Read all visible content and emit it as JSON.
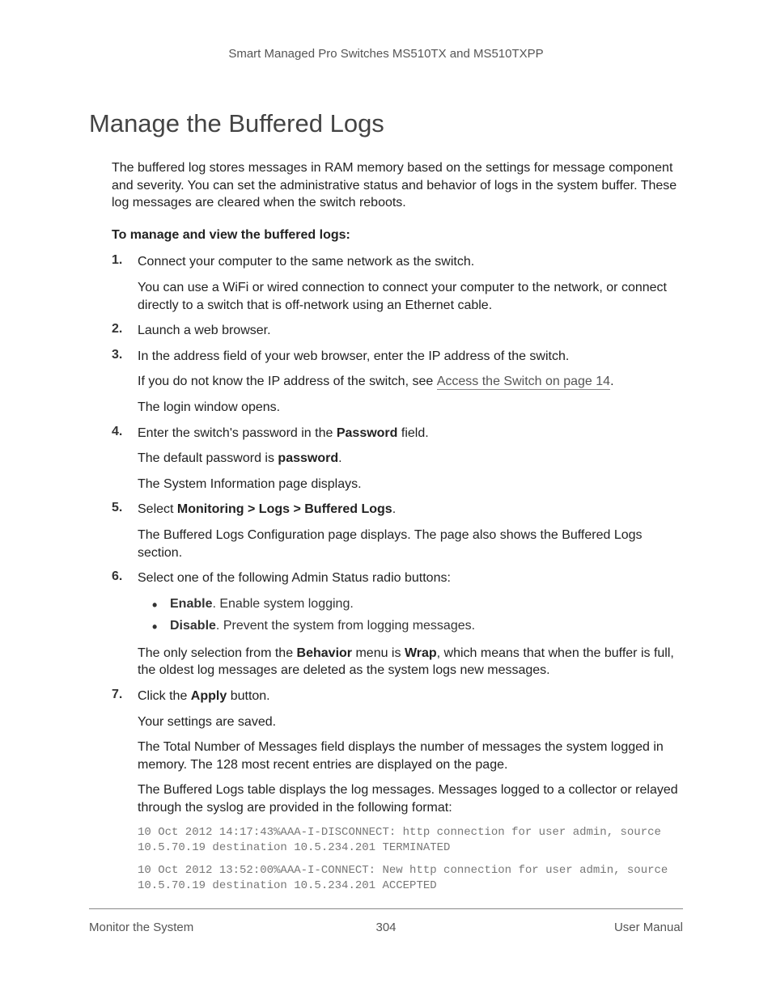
{
  "header": "Smart Managed Pro Switches MS510TX and MS510TXPP",
  "title": "Manage the Buffered Logs",
  "intro": "The buffered log stores messages in RAM memory based on the settings for message component and severity. You can set the administrative status and behavior of logs in the system buffer. These log messages are cleared when the switch reboots.",
  "procHeading": "To manage and view the buffered logs:",
  "steps": {
    "s1": {
      "main": "Connect your computer to the same network as the switch.",
      "sub": "You can use a WiFi or wired connection to connect your computer to the network, or connect directly to a switch that is off-network using an Ethernet cable."
    },
    "s2": {
      "main": "Launch a web browser."
    },
    "s3": {
      "main": "In the address field of your web browser, enter the IP address of the switch.",
      "sub_pre": "If you do not know the IP address of the switch, see ",
      "link": "Access the Switch on page 14",
      "sub_post": ".",
      "sub2": "The login window opens."
    },
    "s4": {
      "main_pre": "Enter the switch's password in the ",
      "main_bold": "Password",
      "main_post": " field.",
      "sub_pre": "The default password is ",
      "sub_bold": "password",
      "sub_post": ".",
      "sub2": "The System Information page displays."
    },
    "s5": {
      "main_pre": "Select ",
      "main_bold": "Monitoring > Logs > Buffered Logs",
      "main_post": ".",
      "sub": "The Buffered Logs Configuration page displays. The page also shows the Buffered Logs section."
    },
    "s6": {
      "main": "Select one of the following Admin Status radio buttons:",
      "b1_bold": "Enable",
      "b1_rest": ". Enable system logging.",
      "b2_bold": "Disable",
      "b2_rest": ". Prevent the system from logging messages.",
      "sub_pre": "The only selection from the ",
      "sub_b1": "Behavior",
      "sub_mid": " menu is ",
      "sub_b2": "Wrap",
      "sub_post": ", which means that when the buffer is full, the oldest log messages are deleted as the system logs new messages."
    },
    "s7": {
      "main_pre": "Click the ",
      "main_bold": "Apply",
      "main_post": " button.",
      "sub1": "Your settings are saved.",
      "sub2": "The Total Number of Messages field displays the number of messages the system logged in memory. The 128 most recent entries are displayed on the page.",
      "sub3": "The Buffered Logs table displays the log messages. Messages logged to a collector or relayed through the syslog are provided in the following format:",
      "code1": "10 Oct 2012 14:17:43%AAA-I-DISCONNECT: http connection for user admin, source 10.5.70.19 destination 10.5.234.201 TERMINATED",
      "code2": "10 Oct 2012 13:52:00%AAA-I-CONNECT: New http connection for user admin, source 10.5.70.19 destination 10.5.234.201 ACCEPTED"
    }
  },
  "footer": {
    "left": "Monitor the System",
    "center": "304",
    "right": "User Manual"
  }
}
